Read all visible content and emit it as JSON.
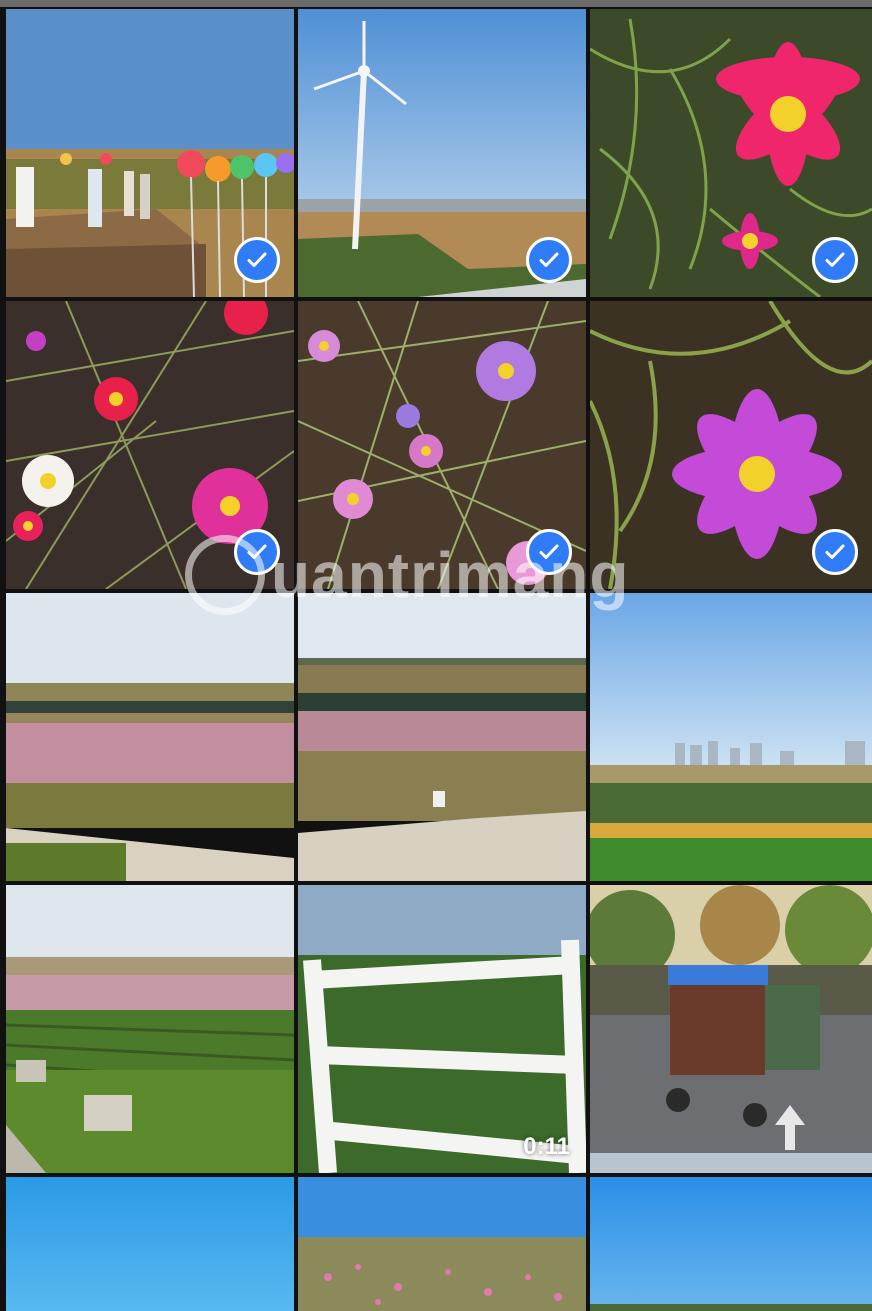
{
  "gallery": {
    "video_duration": "0:11",
    "watermark_text": "uantrimang"
  },
  "selection": {
    "check_color": "#2f7cf6"
  },
  "tiles": [
    {
      "name": "photo-pinwheel-deck",
      "selected": true
    },
    {
      "name": "photo-wind-turbine",
      "selected": true
    },
    {
      "name": "photo-pink-cosmos",
      "selected": true
    },
    {
      "name": "photo-mixed-cosmos",
      "selected": true
    },
    {
      "name": "photo-lilac-cosmos-bush",
      "selected": true
    },
    {
      "name": "photo-magenta-cosmos",
      "selected": true
    },
    {
      "name": "photo-field-cypress-1",
      "selected": false
    },
    {
      "name": "photo-field-cypress-2",
      "selected": false
    },
    {
      "name": "photo-city-skyline-field",
      "selected": false
    },
    {
      "name": "photo-farm-rows",
      "selected": false
    },
    {
      "name": "video-white-fence",
      "selected": false
    },
    {
      "name": "photo-pedal-carts",
      "selected": false
    },
    {
      "name": "photo-blue-sky",
      "selected": false
    },
    {
      "name": "photo-flower-meadow",
      "selected": false
    },
    {
      "name": "photo-sky-horizon",
      "selected": false
    }
  ]
}
